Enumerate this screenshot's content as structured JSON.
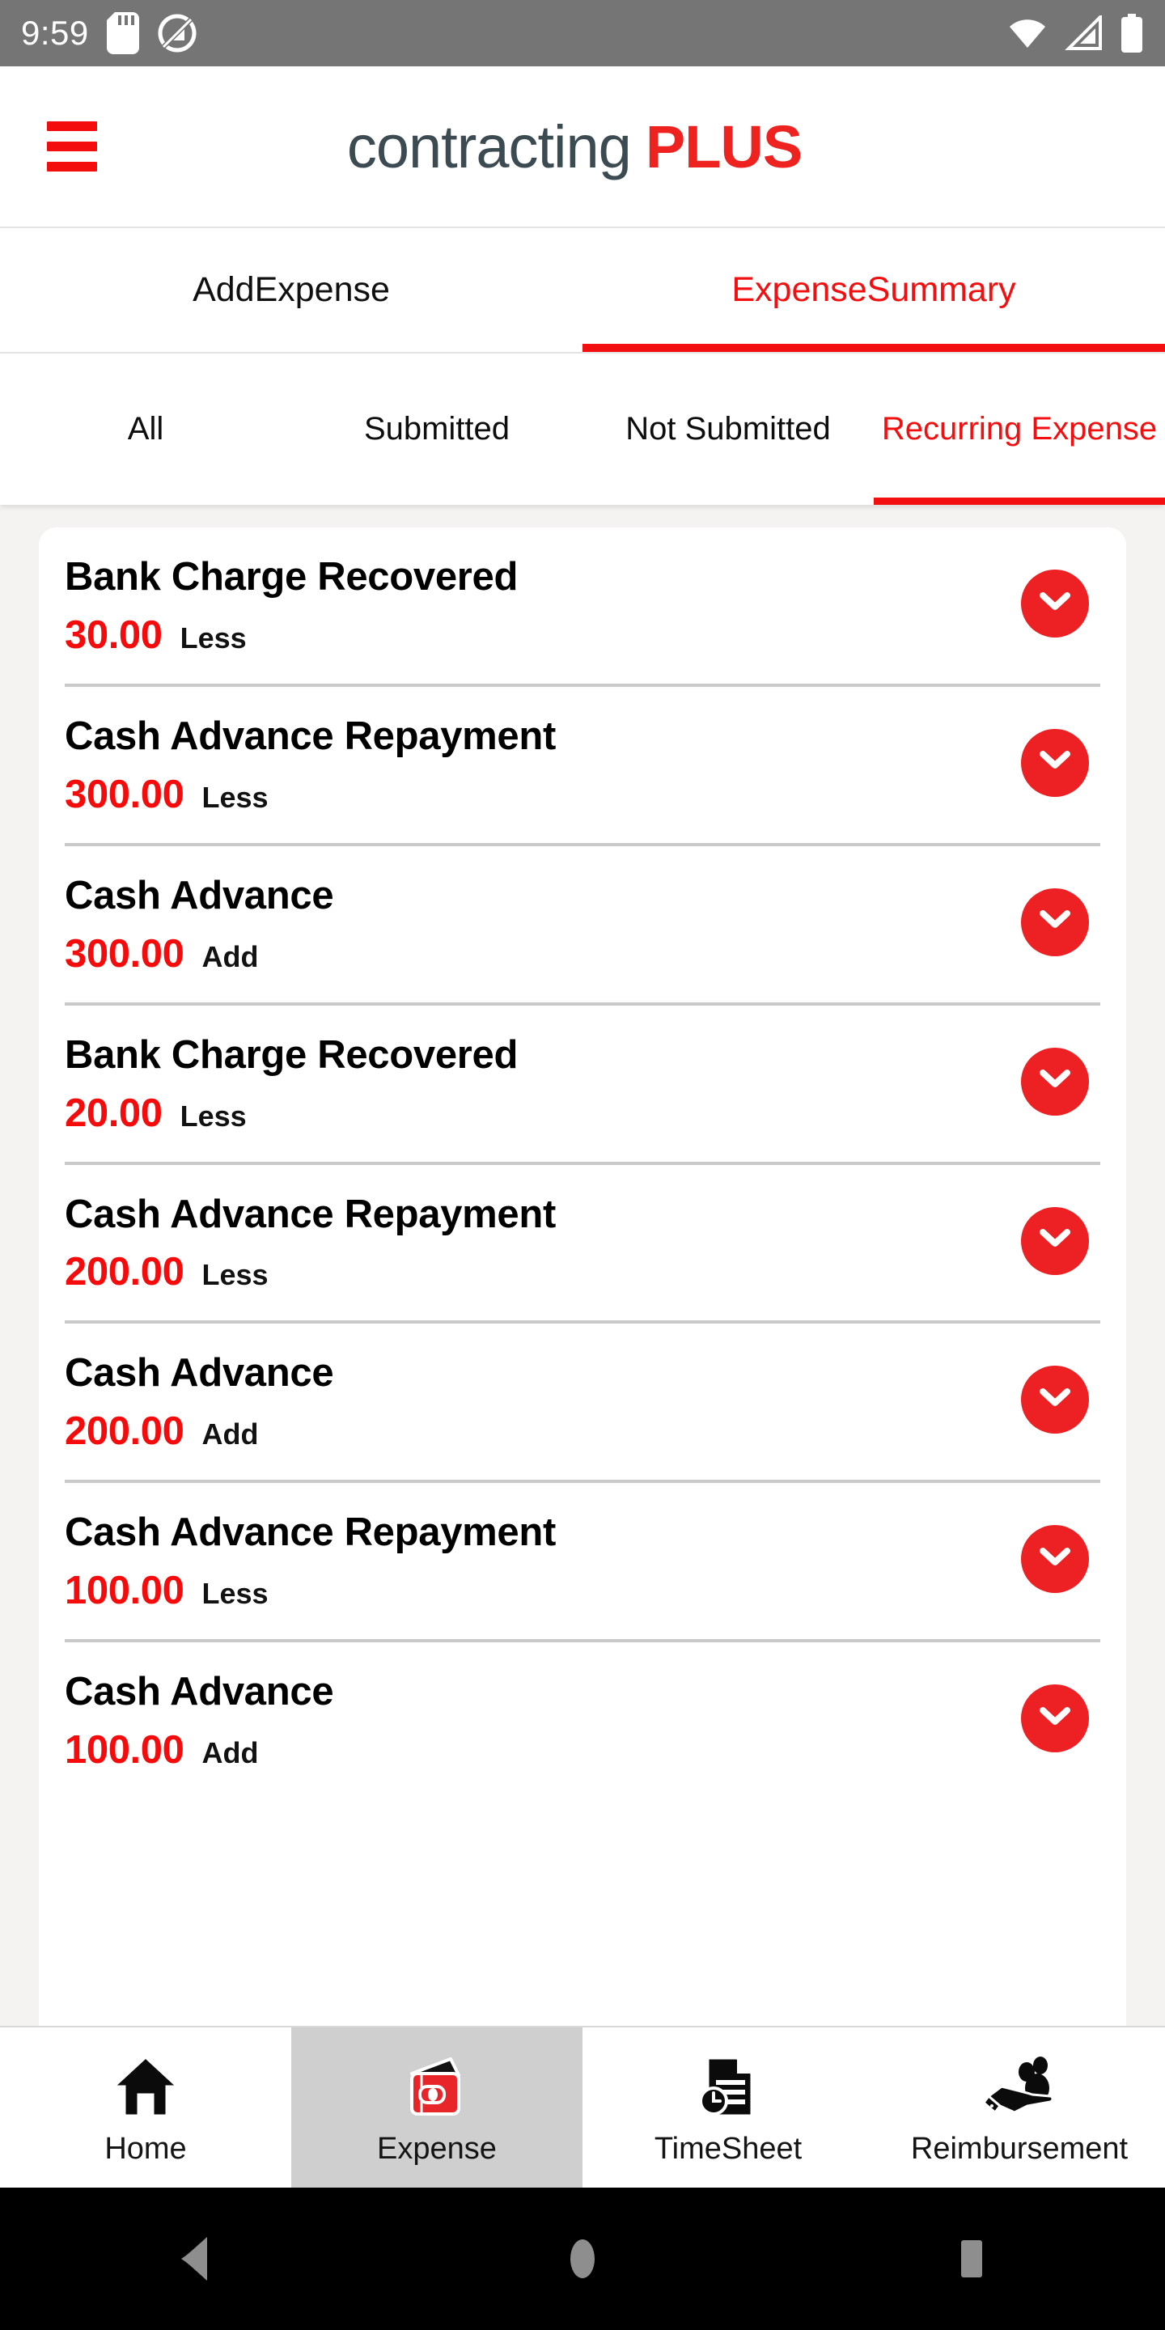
{
  "status_bar": {
    "time": "9:59",
    "icons": [
      "sd-card-icon",
      "do-not-disturb-icon",
      "wifi-icon",
      "cellular-signal-icon",
      "battery-icon"
    ]
  },
  "header": {
    "menu_icon": "hamburger-menu-icon",
    "brand_primary": "contracting",
    "brand_accent": "PLUS"
  },
  "main_tabs": [
    {
      "label": "AddExpense",
      "active": false
    },
    {
      "label": "ExpenseSummary",
      "active": true
    }
  ],
  "sub_tabs": [
    {
      "label": "All",
      "active": false
    },
    {
      "label": "Submitted",
      "active": false
    },
    {
      "label": "Not Submitted",
      "active": false
    },
    {
      "label": "Recurring Expense",
      "active": true
    }
  ],
  "expenses": [
    {
      "title": "Bank Charge Recovered",
      "amount": "30.00",
      "type": "Less",
      "expand_icon": "chevron-down-icon"
    },
    {
      "title": "Cash Advance Repayment",
      "amount": "300.00",
      "type": "Less",
      "expand_icon": "chevron-down-icon"
    },
    {
      "title": "Cash Advance",
      "amount": "300.00",
      "type": "Add",
      "expand_icon": "chevron-down-icon"
    },
    {
      "title": "Bank Charge Recovered",
      "amount": "20.00",
      "type": "Less",
      "expand_icon": "chevron-down-icon"
    },
    {
      "title": "Cash Advance Repayment",
      "amount": "200.00",
      "type": "Less",
      "expand_icon": "chevron-down-icon"
    },
    {
      "title": "Cash Advance",
      "amount": "200.00",
      "type": "Add",
      "expand_icon": "chevron-down-icon"
    },
    {
      "title": "Cash Advance Repayment",
      "amount": "100.00",
      "type": "Less",
      "expand_icon": "chevron-down-icon"
    },
    {
      "title": "Cash Advance",
      "amount": "100.00",
      "type": "Add",
      "expand_icon": "chevron-down-icon"
    }
  ],
  "bottom_nav": [
    {
      "label": "Home",
      "icon": "home-icon",
      "selected": false
    },
    {
      "label": "Expense",
      "icon": "wallet-icon",
      "selected": true
    },
    {
      "label": "TimeSheet",
      "icon": "document-clock-icon",
      "selected": false
    },
    {
      "label": "Reimbursement",
      "icon": "hand-people-icon",
      "selected": false
    }
  ],
  "system_nav": [
    {
      "icon": "back-triangle-icon"
    },
    {
      "icon": "home-circle-icon"
    },
    {
      "icon": "recents-square-icon"
    }
  ],
  "colors": {
    "accent_red": "#ED2024",
    "brand_dark": "#3C4B51",
    "page_bg": "#F4F3F2",
    "status_bar": "#757575",
    "selected_nav": "#CFCFCF"
  }
}
